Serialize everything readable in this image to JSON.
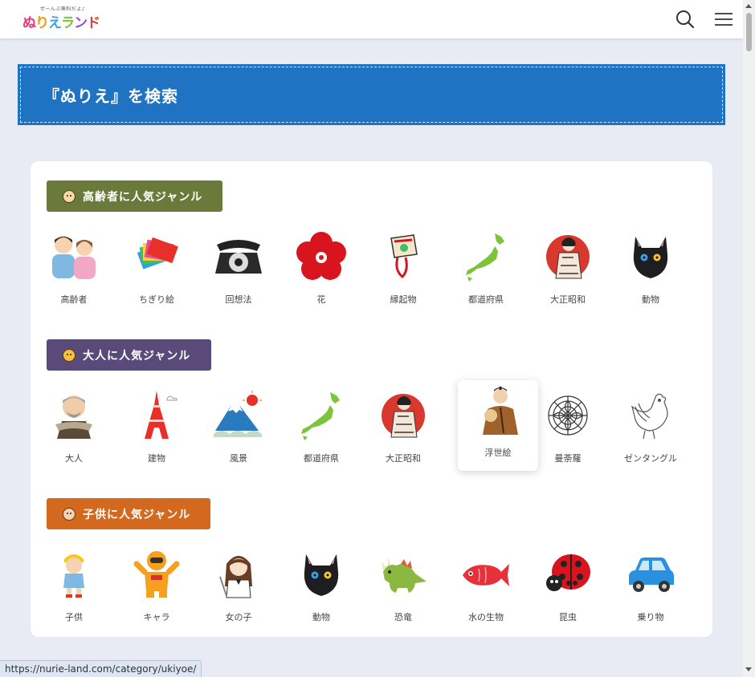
{
  "header": {
    "logo_small": "ぜーんぶ無料だよ♪",
    "logo_chars": [
      "ぬ",
      "り",
      "え",
      "ラ",
      "ン",
      "ド"
    ],
    "search_icon": "search-icon",
    "menu_icon": "hamburger-menu-icon"
  },
  "search_banner": {
    "title": "『ぬりえ』を検索"
  },
  "sections": [
    {
      "title": "高齢者に人気ジャンル",
      "color": "#6b7a3a",
      "items": [
        {
          "label": "高齢者",
          "icon": "elderly-couple-icon"
        },
        {
          "label": "ちぎり絵",
          "icon": "torn-paper-icon"
        },
        {
          "label": "回想法",
          "icon": "rotary-phone-icon"
        },
        {
          "label": "花",
          "icon": "plum-blossom-icon"
        },
        {
          "label": "縁起物",
          "icon": "lucky-charm-icon"
        },
        {
          "label": "都道府県",
          "icon": "japan-map-icon"
        },
        {
          "label": "大正昭和",
          "icon": "taisho-woman-icon"
        },
        {
          "label": "動物",
          "icon": "black-cat-icon"
        }
      ]
    },
    {
      "title": "大人に人気ジャンル",
      "color": "#5a4a7a",
      "items": [
        {
          "label": "大人",
          "icon": "adult-man-icon"
        },
        {
          "label": "建物",
          "icon": "tokyo-tower-icon"
        },
        {
          "label": "風景",
          "icon": "mount-fuji-icon"
        },
        {
          "label": "都道府県",
          "icon": "japan-map-icon"
        },
        {
          "label": "大正昭和",
          "icon": "taisho-woman-icon"
        },
        {
          "label": "浮世絵",
          "icon": "ukiyoe-icon"
        },
        {
          "label": "曼荼羅",
          "icon": "mandala-icon"
        },
        {
          "label": "ゼンタングル",
          "icon": "zentangle-rooster-icon"
        }
      ]
    },
    {
      "title": "子供に人気ジャンル",
      "color": "#d2691e",
      "items": [
        {
          "label": "子供",
          "icon": "child-icon"
        },
        {
          "label": "キャラ",
          "icon": "character-icon"
        },
        {
          "label": "女の子",
          "icon": "girl-icon"
        },
        {
          "label": "動物",
          "icon": "black-cat-icon"
        },
        {
          "label": "恐竜",
          "icon": "dinosaur-icon"
        },
        {
          "label": "水の生物",
          "icon": "red-fish-icon"
        },
        {
          "label": "昆虫",
          "icon": "ladybug-icon"
        },
        {
          "label": "乗り物",
          "icon": "car-icon"
        }
      ]
    }
  ],
  "status_bar": {
    "url": "https://nurie-land.com/category/ukiyoe/"
  }
}
